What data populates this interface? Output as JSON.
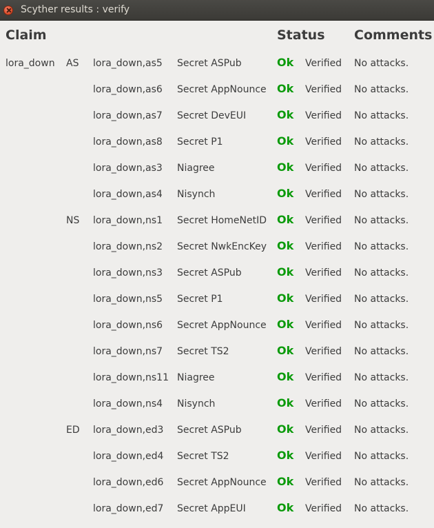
{
  "window": {
    "title": "Scyther results : verify"
  },
  "headers": {
    "claim": "Claim",
    "status": "Status",
    "comments": "Comments"
  },
  "rows": [
    {
      "protocol": "lora_down",
      "role": "AS",
      "label": "lora_down,as5",
      "claim": "Secret ASPub",
      "status": "Ok",
      "result": "Verified",
      "comment": "No attacks."
    },
    {
      "protocol": "",
      "role": "",
      "label": "lora_down,as6",
      "claim": "Secret AppNounce",
      "status": "Ok",
      "result": "Verified",
      "comment": "No attacks."
    },
    {
      "protocol": "",
      "role": "",
      "label": "lora_down,as7",
      "claim": "Secret DevEUI",
      "status": "Ok",
      "result": "Verified",
      "comment": "No attacks."
    },
    {
      "protocol": "",
      "role": "",
      "label": "lora_down,as8",
      "claim": "Secret P1",
      "status": "Ok",
      "result": "Verified",
      "comment": "No attacks."
    },
    {
      "protocol": "",
      "role": "",
      "label": "lora_down,as3",
      "claim": "Niagree",
      "status": "Ok",
      "result": "Verified",
      "comment": "No attacks."
    },
    {
      "protocol": "",
      "role": "",
      "label": "lora_down,as4",
      "claim": "Nisynch",
      "status": "Ok",
      "result": "Verified",
      "comment": "No attacks."
    },
    {
      "protocol": "",
      "role": "NS",
      "label": "lora_down,ns1",
      "claim": "Secret HomeNetID",
      "status": "Ok",
      "result": "Verified",
      "comment": "No attacks."
    },
    {
      "protocol": "",
      "role": "",
      "label": "lora_down,ns2",
      "claim": "Secret NwkEncKey",
      "status": "Ok",
      "result": "Verified",
      "comment": "No attacks."
    },
    {
      "protocol": "",
      "role": "",
      "label": "lora_down,ns3",
      "claim": "Secret ASPub",
      "status": "Ok",
      "result": "Verified",
      "comment": "No attacks."
    },
    {
      "protocol": "",
      "role": "",
      "label": "lora_down,ns5",
      "claim": "Secret P1",
      "status": "Ok",
      "result": "Verified",
      "comment": "No attacks."
    },
    {
      "protocol": "",
      "role": "",
      "label": "lora_down,ns6",
      "claim": "Secret AppNounce",
      "status": "Ok",
      "result": "Verified",
      "comment": "No attacks."
    },
    {
      "protocol": "",
      "role": "",
      "label": "lora_down,ns7",
      "claim": "Secret TS2",
      "status": "Ok",
      "result": "Verified",
      "comment": "No attacks."
    },
    {
      "protocol": "",
      "role": "",
      "label": "lora_down,ns11",
      "claim": "Niagree",
      "status": "Ok",
      "result": "Verified",
      "comment": "No attacks."
    },
    {
      "protocol": "",
      "role": "",
      "label": "lora_down,ns4",
      "claim": "Nisynch",
      "status": "Ok",
      "result": "Verified",
      "comment": "No attacks."
    },
    {
      "protocol": "",
      "role": "ED",
      "label": "lora_down,ed3",
      "claim": "Secret ASPub",
      "status": "Ok",
      "result": "Verified",
      "comment": "No attacks."
    },
    {
      "protocol": "",
      "role": "",
      "label": "lora_down,ed4",
      "claim": "Secret TS2",
      "status": "Ok",
      "result": "Verified",
      "comment": "No attacks."
    },
    {
      "protocol": "",
      "role": "",
      "label": "lora_down,ed6",
      "claim": "Secret AppNounce",
      "status": "Ok",
      "result": "Verified",
      "comment": "No attacks."
    },
    {
      "protocol": "",
      "role": "",
      "label": "lora_down,ed7",
      "claim": "Secret AppEUI",
      "status": "Ok",
      "result": "Verified",
      "comment": "No attacks."
    }
  ],
  "colors": {
    "ok": "#0a9a0a",
    "background": "#efeeec",
    "titlebar": "#3b3a36"
  }
}
